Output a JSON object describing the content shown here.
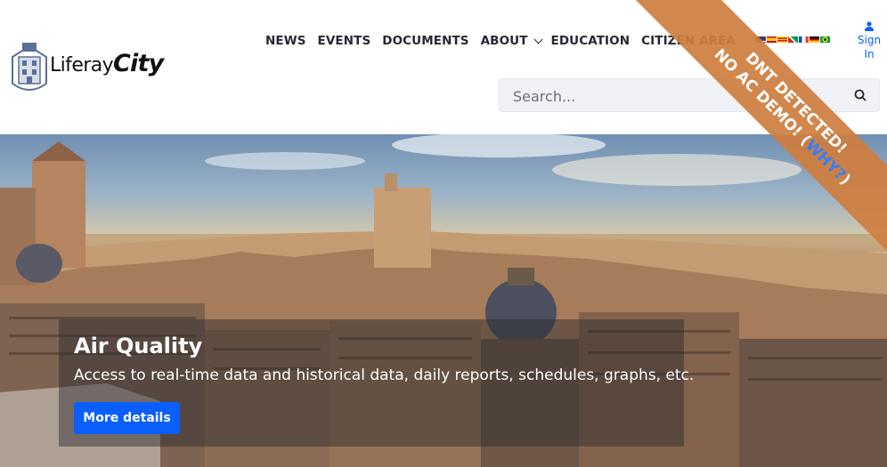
{
  "header": {
    "logo": {
      "text_a": "Liferay",
      "text_b": "City"
    },
    "nav": [
      {
        "label": "NEWS",
        "dropdown": false
      },
      {
        "label": "EVENTS",
        "dropdown": false
      },
      {
        "label": "DOCUMENTS",
        "dropdown": false
      },
      {
        "label": "ABOUT",
        "dropdown": true
      },
      {
        "label": "EDUCATION",
        "dropdown": false
      },
      {
        "label": "CITIZEN AREA",
        "dropdown": false
      }
    ],
    "languages": [
      "en-US",
      "es-ES",
      "ca-ES",
      "eu-ES",
      "fr-FR",
      "de-DE",
      "pt-BR"
    ],
    "sign_in": {
      "line1": "Sign",
      "line2": "In"
    },
    "search": {
      "placeholder": "Search...",
      "icon": "search-icon"
    }
  },
  "hero": {
    "title": "Air Quality",
    "description": "Access to real-time data and historical data, daily reports, schedules, graphs, etc.",
    "button_label": "More details"
  },
  "ribbon": {
    "line1": "DNT DETECTED!",
    "line2_prefix": "NO AC DEMO! (",
    "line2_link": "WHY?",
    "line2_suffix": ")"
  },
  "colors": {
    "primary": "#0b5fff",
    "ribbon": "#cf7e3f",
    "text": "#272833"
  }
}
